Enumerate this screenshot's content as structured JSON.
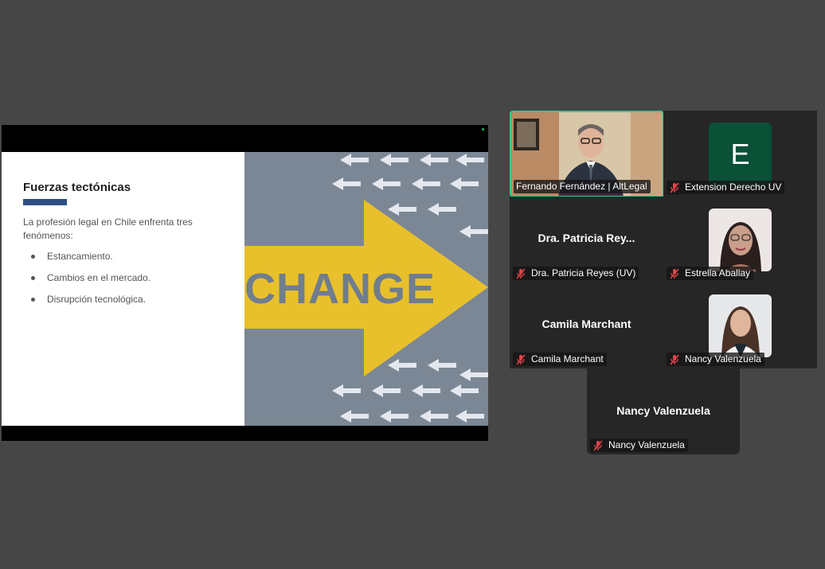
{
  "slide": {
    "title": "Fuerzas tectónicas",
    "intro": "La profesión legal en Chile enfrenta tres fenómenos:",
    "bullets": [
      "Estancamiento.",
      "Cambios en el mercado.",
      "Disrupción tecnológica."
    ],
    "image_word": "CHANGE"
  },
  "colors": {
    "title_bar": "#2d4e86",
    "active_speaker_border": "#35c98f",
    "avatar_e": "#0a5138",
    "muted_mic": "#e0444a"
  },
  "participants": [
    {
      "display_name": "Fernando Fernández | AltLegal",
      "video": true,
      "active": true
    },
    {
      "display_name": "Extension Derecho UV",
      "avatar_letter": "E",
      "muted": true
    },
    {
      "display_name": "Dra. Patricia Reyes (UV)",
      "center_label": "Dra. Patricia Rey...",
      "muted": true
    },
    {
      "display_name": "Estrella Aballay",
      "photo": true,
      "muted": true
    },
    {
      "display_name": "Camila Marchant",
      "center_label": "Camila Marchant",
      "muted": true
    },
    {
      "display_name": "Nancy Valenzuela",
      "photo": true,
      "muted": true
    },
    {
      "display_name": "Nancy Valenzuela",
      "center_label": "Nancy Valenzuela",
      "muted": true
    }
  ],
  "icons": {
    "mic": "mic-muted-icon"
  }
}
